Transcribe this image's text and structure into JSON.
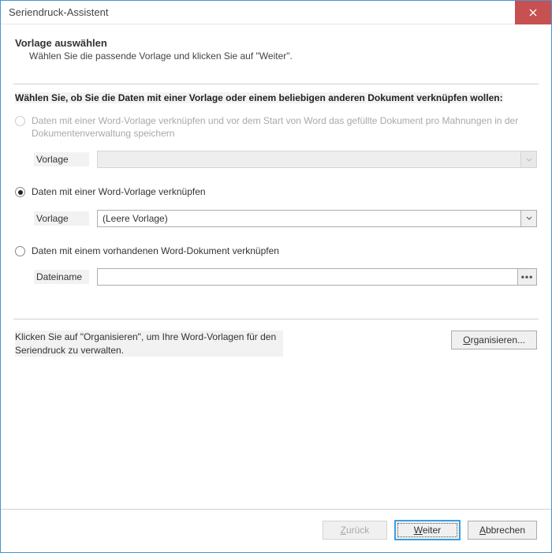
{
  "titlebar": {
    "title": "Seriendruck-Assistent"
  },
  "header": {
    "heading": "Vorlage auswählen",
    "sub": "Wählen Sie die passende Vorlage und klicken Sie auf \"Weiter\"."
  },
  "prompt": "Wählen Sie, ob Sie die Daten mit einer Vorlage oder einem beliebigen anderen Dokument verknüpfen wollen:",
  "options": {
    "a": {
      "label": "Daten mit einer Word-Vorlage verknüpfen und vor dem Start von Word das gefüllte Dokument pro Mahnungen in der Dokumentenverwaltung speichern",
      "fieldLabel": "Vorlage",
      "value": "",
      "checked": false,
      "enabled": false
    },
    "b": {
      "label": "Daten mit einer Word-Vorlage verknüpfen",
      "fieldLabel": "Vorlage",
      "value": "(Leere Vorlage)",
      "checked": true,
      "enabled": true
    },
    "c": {
      "label": "Daten mit einem vorhandenen Word-Dokument verknüpfen",
      "fieldLabel": "Dateiname",
      "value": "",
      "checked": false,
      "enabled": true
    }
  },
  "organize": {
    "text": "Klicken Sie auf \"Organisieren\", um Ihre Word-Vorlagen für den Seriendruck zu verwalten.",
    "btn_prefix": "O",
    "btn_rest": "rganisieren..."
  },
  "footer": {
    "back_prefix": "Z",
    "back_rest": "urück",
    "next_prefix": "W",
    "next_rest": "eiter",
    "cancel_prefix": "A",
    "cancel_rest": "bbrechen"
  }
}
